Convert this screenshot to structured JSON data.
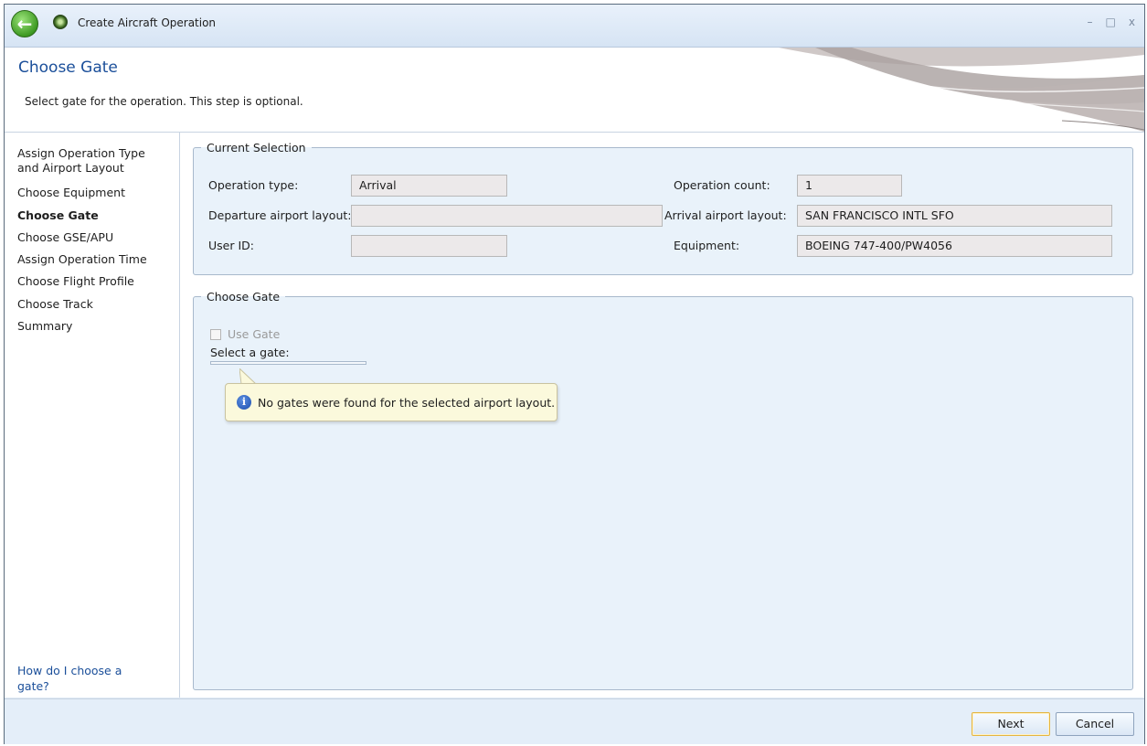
{
  "window": {
    "title": "Create Aircraft Operation",
    "controls": {
      "minimize": "–",
      "maximize": "□",
      "close": "x"
    }
  },
  "header": {
    "title": "Choose Gate",
    "subtitle": "Select gate for the operation. This step is optional."
  },
  "sidebar": {
    "items": [
      {
        "label": "Assign Operation Type and Airport Layout",
        "active": false
      },
      {
        "label": "Choose Equipment",
        "active": false
      },
      {
        "label": "Choose Gate",
        "active": true
      },
      {
        "label": "Choose GSE/APU",
        "active": false
      },
      {
        "label": "Assign Operation Time",
        "active": false
      },
      {
        "label": "Choose Flight Profile",
        "active": false
      },
      {
        "label": "Choose Track",
        "active": false
      },
      {
        "label": "Summary",
        "active": false
      }
    ],
    "help_link": "How do I choose a gate?"
  },
  "current_selection": {
    "legend": "Current Selection",
    "operation_type": {
      "label": "Operation type:",
      "value": "Arrival"
    },
    "departure_layout": {
      "label": "Departure airport layout:",
      "value": ""
    },
    "user_id": {
      "label": "User ID:",
      "value": ""
    },
    "operation_count": {
      "label": "Operation count:",
      "value": "1"
    },
    "arrival_layout": {
      "label": "Arrival airport layout:",
      "value": "SAN FRANCISCO INTL SFO"
    },
    "equipment": {
      "label": "Equipment:",
      "value": "BOEING 747-400/PW4056"
    }
  },
  "choose_gate": {
    "legend": "Choose Gate",
    "use_gate_label": "Use Gate",
    "use_gate_checked": false,
    "select_label": "Select a gate:",
    "tooltip": "No gates were found for the selected airport layout.",
    "info_icon": "i"
  },
  "footer": {
    "next_label": "Next",
    "cancel_label": "Cancel"
  },
  "colors": {
    "accent": "#1b4f9a",
    "panel": "#e9f2fa",
    "tooltip": "#fbf9dc",
    "back_button": "#3e9a23"
  }
}
